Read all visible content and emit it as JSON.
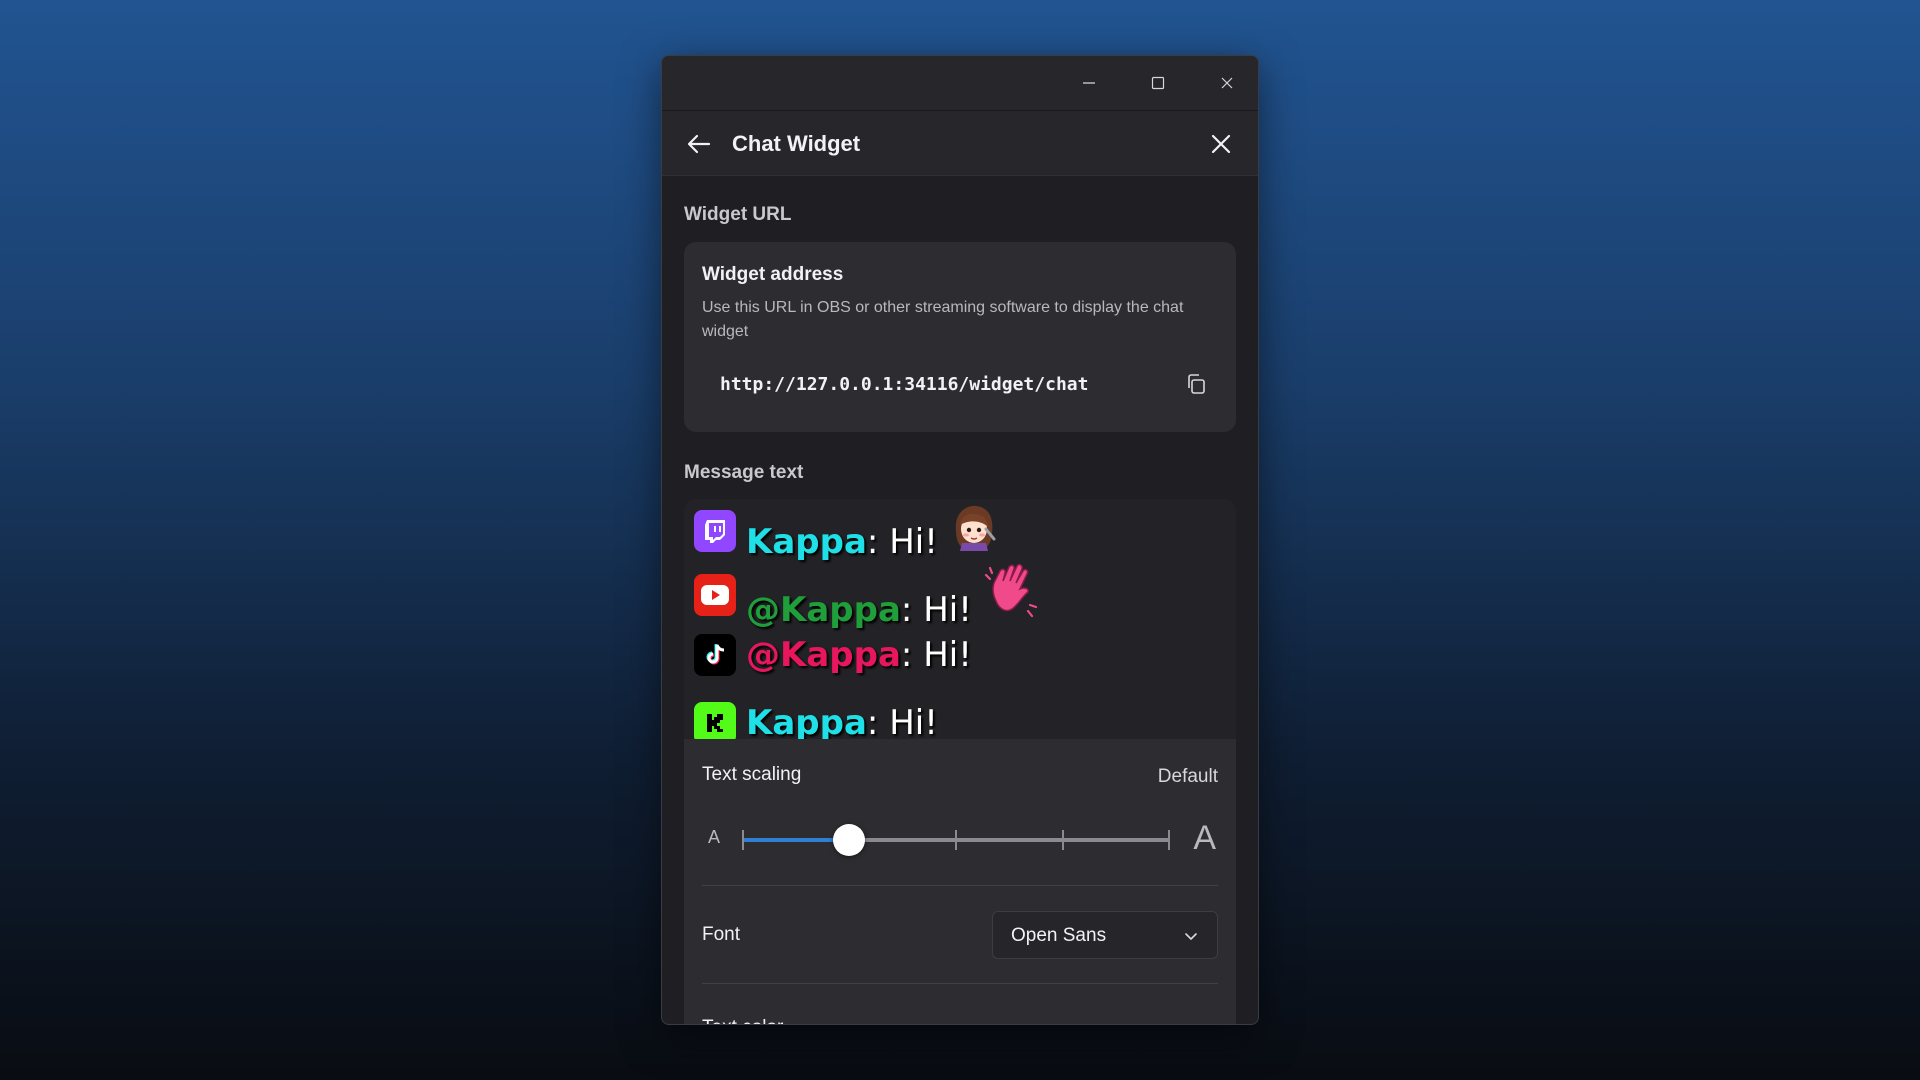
{
  "window": {
    "title_controls": [
      "minimize",
      "maximize",
      "close"
    ]
  },
  "header": {
    "title": "Chat Widget",
    "back_icon": "arrow-left-icon",
    "close_icon": "close-icon"
  },
  "widget_url_section": {
    "label": "Widget URL",
    "card_title": "Widget address",
    "card_description": "Use this URL in OBS or other streaming software to display the chat widget",
    "url": "http://127.0.0.1:34116/widget/chat",
    "copy_icon": "copy-icon"
  },
  "message_text_section": {
    "label": "Message text",
    "preview_messages": [
      {
        "platform": "twitch",
        "user": "Kappa",
        "separator": ":",
        "text": " Hi!",
        "user_color": "#1fe0e6",
        "icon_color": "#9146ff",
        "emote": "girl-emote"
      },
      {
        "platform": "youtube",
        "user": "@Kappa",
        "separator": ":",
        "text": " Hi!",
        "user_color": "#1f9e3a",
        "icon_color": "#e62117",
        "emote": "waving-hand-emote"
      },
      {
        "platform": "tiktok",
        "user": "@Kappa",
        "separator": ":",
        "text": " Hi!",
        "user_color": "#e8175d",
        "icon_color": "#000000",
        "emote": ""
      },
      {
        "platform": "kick",
        "user": "Kappa",
        "separator": ":",
        "text": " Hi!",
        "user_color": "#1fe0e6",
        "icon_color": "#53fc18",
        "emote": ""
      }
    ]
  },
  "settings": {
    "text_scaling_label": "Text scaling",
    "text_scaling_value": "Default",
    "slider_small_label": "A",
    "slider_large_label": "A",
    "slider_value": 0.25,
    "slider_steps": 5,
    "font_label": "Font",
    "font_value": "Open Sans",
    "next_label": "Text color"
  },
  "colors": {
    "accent": "#2f7fd4",
    "background": "#1f1f23",
    "card": "#2c2c31"
  }
}
